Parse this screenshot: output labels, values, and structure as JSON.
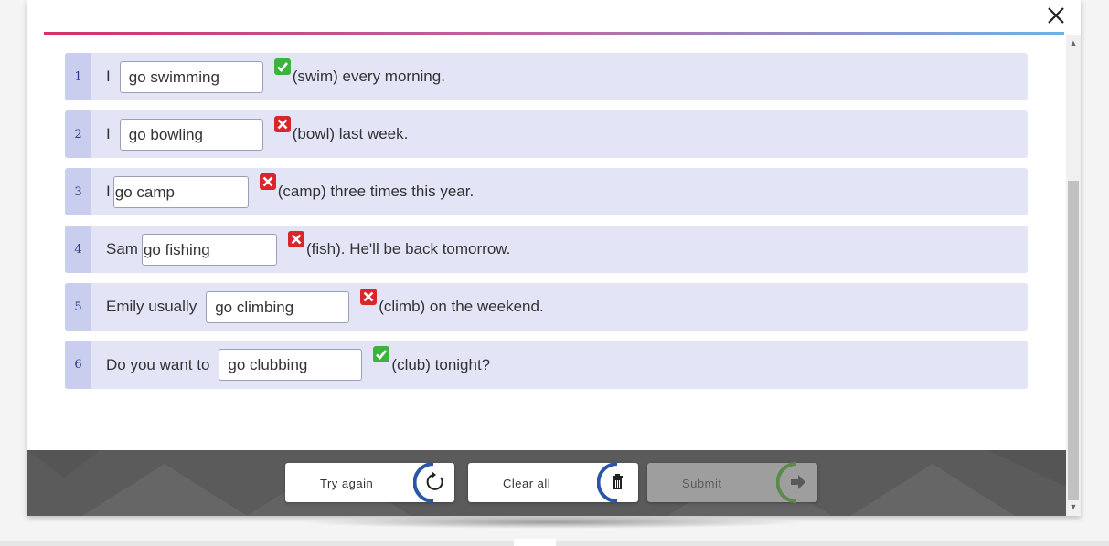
{
  "exercise": {
    "rows": [
      {
        "num": "1",
        "before": "I",
        "answer": "go swimming",
        "status": "correct",
        "after": "(swim) every morning."
      },
      {
        "num": "2",
        "before": "I",
        "answer": "go bowling",
        "status": "incorrect",
        "after": "(bowl) last week."
      },
      {
        "num": "3",
        "before": "I",
        "answer": "go camp",
        "status": "incorrect",
        "after": "(camp) three times this year."
      },
      {
        "num": "4",
        "before": "Sam",
        "answer": "go fishing",
        "status": "incorrect",
        "after": "(fish). He'll be back tomorrow."
      },
      {
        "num": "5",
        "before": "Emily usually",
        "answer": "go climbing",
        "status": "incorrect",
        "after": "(climb) on the weekend."
      },
      {
        "num": "6",
        "before": "Do you want to",
        "answer": "go clubbing",
        "status": "correct",
        "after": "(club) tonight?"
      }
    ]
  },
  "footer": {
    "try_again_label": "Try again",
    "clear_all_label": "Clear all",
    "submit_label": "Submit"
  },
  "icons": {
    "close": "close-icon",
    "correct": "check-icon",
    "incorrect": "cross-icon",
    "try_again": "refresh-icon",
    "clear_all": "trash-icon",
    "submit": "arrow-right-icon"
  },
  "colors": {
    "correct": "#3cb33c",
    "incorrect": "#d9262c",
    "row_bg": "#e3e5f7",
    "num_bg": "#c9cdee",
    "ring_blue": "#2b55a8",
    "ring_green": "#5c8a4c"
  }
}
